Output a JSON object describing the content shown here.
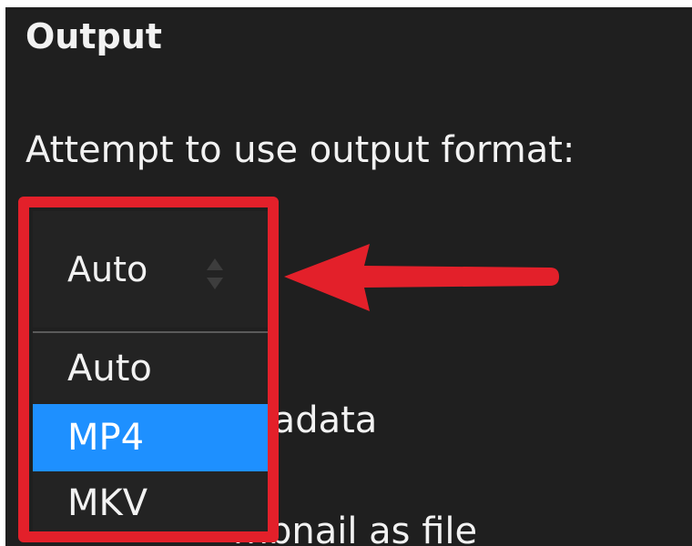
{
  "section": {
    "title": "Output",
    "format_label": "Attempt to use output format:"
  },
  "select": {
    "value": "Auto",
    "options": [
      {
        "label": "Auto",
        "highlighted": false
      },
      {
        "label": "MP4",
        "highlighted": true
      },
      {
        "label": "MKV",
        "highlighted": false
      }
    ]
  },
  "background_text": {
    "metadata_option": "tadata",
    "thumbnail_option": "mbnail as file"
  },
  "annotation": {
    "color": "#e3202a",
    "highlight": "red-rectangle-around-dropdown",
    "arrow": "red-arrow-pointing-left"
  },
  "colors": {
    "background": "#1f1f1f",
    "text": "#f2f2f2",
    "selected_option": "#1e90ff"
  }
}
